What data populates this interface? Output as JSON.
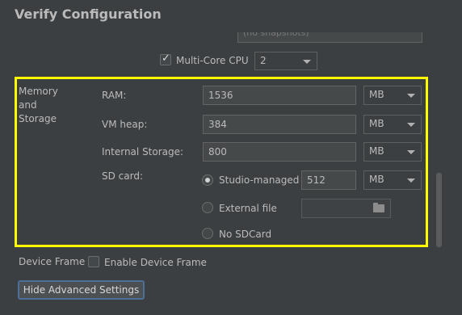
{
  "window": {
    "title": "Verify Configuration"
  },
  "snapshot": {
    "value": "(no snapshots)"
  },
  "multicore": {
    "label": "Multi-Core CPU",
    "checked": true,
    "value": "2"
  },
  "memory": {
    "section_label": "Memory\nand\nStorage",
    "ram": {
      "label": "RAM:",
      "value": "1536",
      "unit": "MB"
    },
    "vm_heap": {
      "label": "VM heap:",
      "value": "384",
      "unit": "MB"
    },
    "internal": {
      "label": "Internal Storage:",
      "value": "800",
      "unit": "MB"
    },
    "sdcard": {
      "label": "SD card:",
      "studio_label": "Studio-managed",
      "studio_value": "512",
      "studio_unit": "MB",
      "external_label": "External file",
      "external_value": "",
      "none_label": "No SDCard"
    }
  },
  "device_frame": {
    "label": "Device Frame",
    "checkbox_label": "Enable Device Frame",
    "checked": false
  },
  "advanced_button": {
    "label": "Hide Advanced Settings"
  },
  "icons": {
    "browse": "folder-icon",
    "dropdown": "chevron-down-icon"
  }
}
